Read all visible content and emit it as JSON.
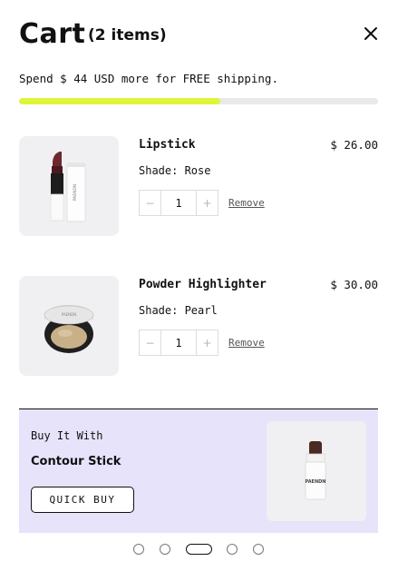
{
  "header": {
    "title": "Cart",
    "item_count": "(2 items)"
  },
  "shipping": {
    "message": "Spend $ 44 USD more for FREE shipping.",
    "progress_fraction": 0.56
  },
  "items": [
    {
      "name": "Lipstick",
      "price": "$ 26.00",
      "shade": "Shade: Rose",
      "quantity": "1",
      "decrease": "−",
      "increase": "+",
      "remove": "Remove",
      "icon": "lipstick-product-image"
    },
    {
      "name": "Powder Highlighter",
      "price": "$ 30.00",
      "shade": "Shade: Pearl",
      "quantity": "1",
      "decrease": "−",
      "increase": "+",
      "remove": "Remove",
      "icon": "compact-powder-product-image"
    }
  ],
  "upsell": {
    "eyebrow": "Buy It With",
    "product_name": "Contour Stick",
    "button_label": "QUICK BUY",
    "stick_label": "PAENDN",
    "icon": "contour-stick-product-image"
  },
  "carousel": {
    "slide_count": 5,
    "active_index": 2
  },
  "colors": {
    "progress_fill": "#dff53a",
    "progress_track": "#e9e9e9",
    "upsell_background": "#e6e3fb",
    "lipstick": "#6e2830"
  }
}
